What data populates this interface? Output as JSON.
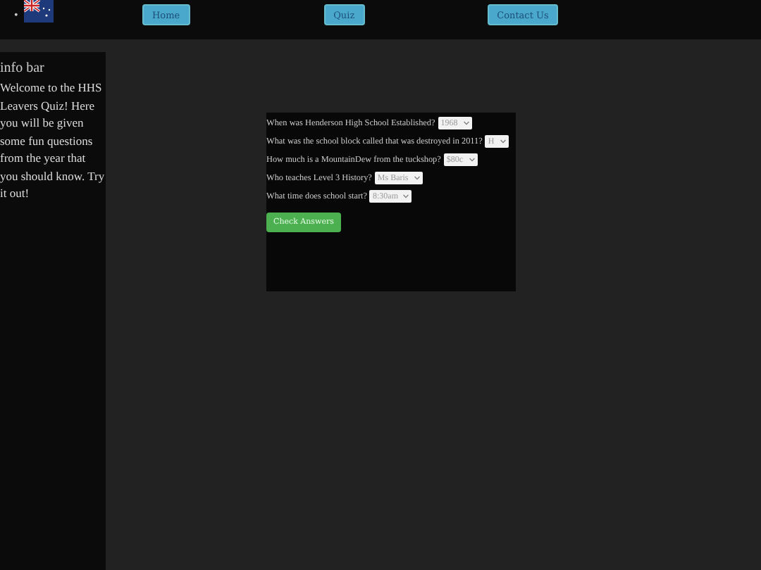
{
  "nav": {
    "bullet": "•",
    "links": [
      "Home",
      "Quiz",
      "Contact Us"
    ]
  },
  "sidebar": {
    "title": "info bar",
    "text": "Welcome to the HHS Leavers Quiz! Here you will be given some fun questions from the year that you should know. Try it out!"
  },
  "quiz": {
    "questions": [
      {
        "label": "When was Henderson High School Established?",
        "value": "1968"
      },
      {
        "label": "What was the school block called that was destroyed in 2011?",
        "value": "H"
      },
      {
        "label": "How much is a MountainDew from the tuckshop?",
        "value": "$80c"
      },
      {
        "label": "Who teaches Level 3 History?",
        "value": "Ms Baris"
      },
      {
        "label": "What time does school start?",
        "value": "8:30am"
      }
    ],
    "button": "Check Answers"
  }
}
